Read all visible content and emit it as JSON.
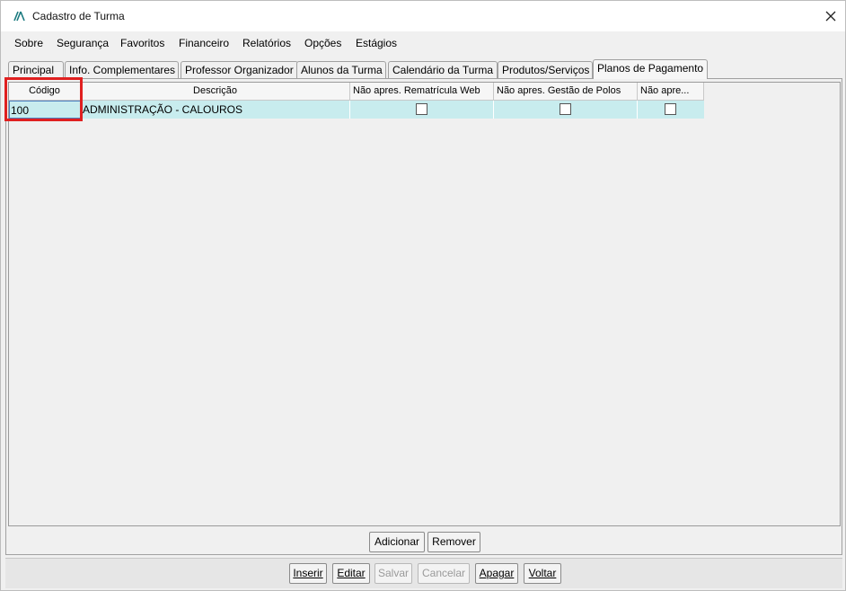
{
  "window": {
    "title": "Cadastro de Turma"
  },
  "menu": {
    "items": [
      "Sobre",
      "Segurança",
      "Favoritos",
      "Financeiro",
      "Relatórios",
      "Opções",
      "Estágios"
    ]
  },
  "tabs": [
    "Principal",
    "Info. Complementares",
    "Professor Organizador",
    "Alunos da Turma",
    "Calendário da Turma",
    "Produtos/Serviços",
    "Planos de Pagamento"
  ],
  "active_tab": "Planos de Pagamento",
  "grid": {
    "columns": [
      "Código",
      "Descrição",
      "Não apres. Rematrícula Web",
      "Não apres. Gestão de Polos",
      "Não apre..."
    ],
    "rows": [
      {
        "codigo": "100",
        "descricao": "ADMINISTRAÇÃO - CALOUROS",
        "rematricula_web": false,
        "gestao_polos": false,
        "nao_apre": false
      }
    ]
  },
  "grid_actions": {
    "add": "Adicionar",
    "remove": "Remover"
  },
  "toolbar": {
    "inserir": "Inserir",
    "editar": "Editar",
    "salvar": "Salvar",
    "cancelar": "Cancelar",
    "apagar": "Apagar",
    "voltar": "Voltar"
  },
  "colors": {
    "row_highlight": "#c8ecee",
    "selection_box": "#e02020"
  }
}
